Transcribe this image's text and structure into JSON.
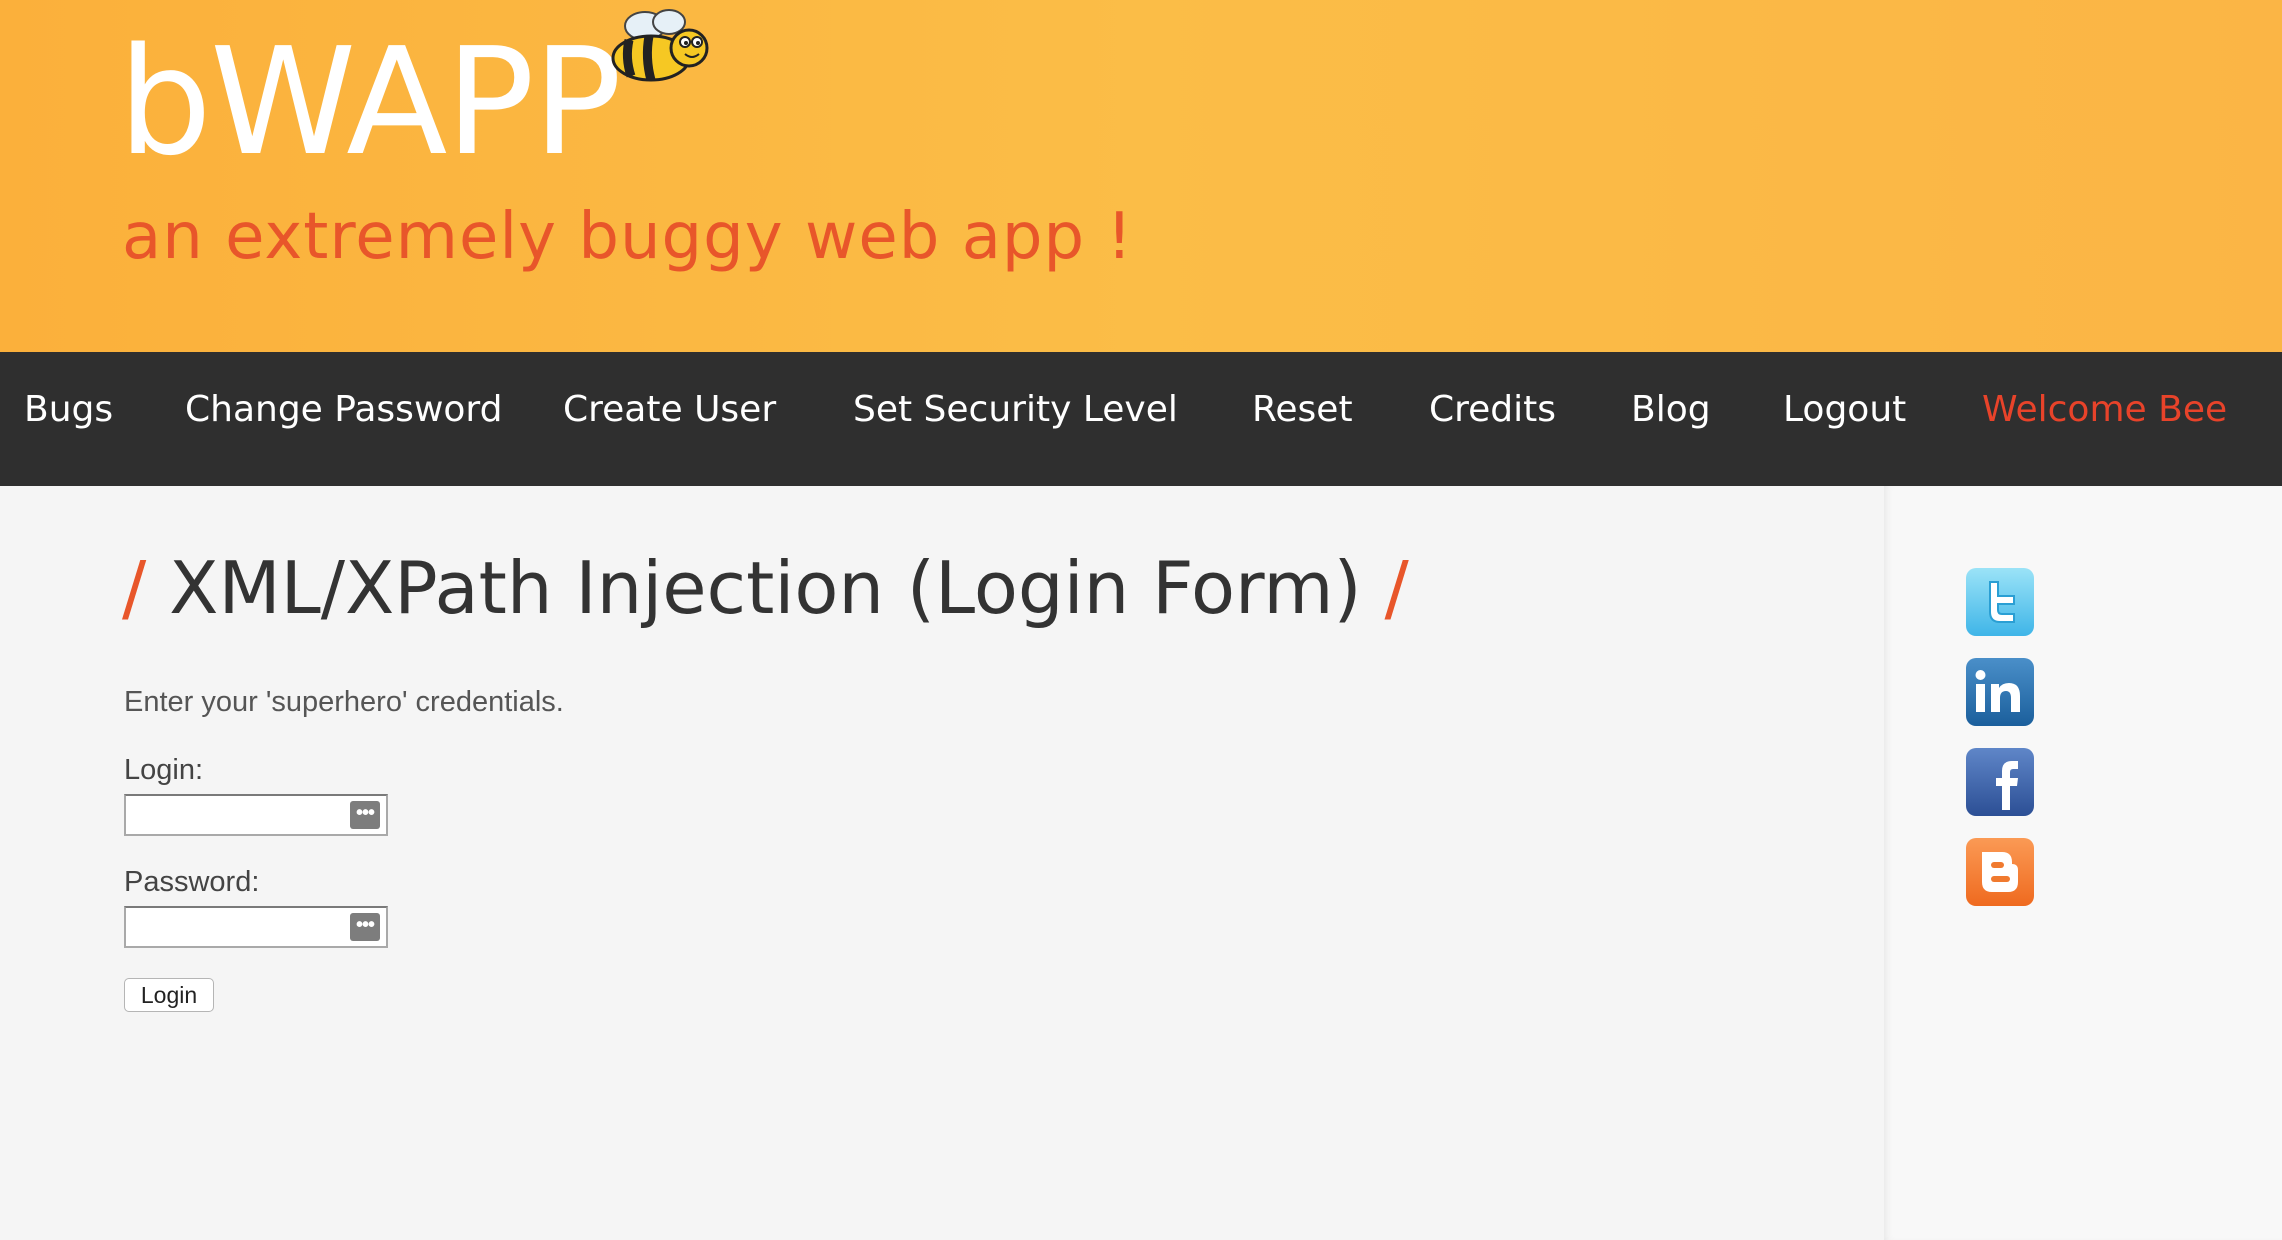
{
  "header": {
    "logo": "bWAPP",
    "tagline": "an extremely buggy web app !"
  },
  "nav": {
    "items": [
      "Bugs",
      "Change Password",
      "Create User",
      "Set Security Level",
      "Reset",
      "Credits",
      "Blog",
      "Logout"
    ],
    "welcome": "Welcome Bee"
  },
  "page": {
    "title_slash_left": "/",
    "title": "XML/XPath Injection (Login Form)",
    "title_slash_right": "/",
    "intro": "Enter your 'superhero' credentials.",
    "login_label": "Login:",
    "login_value": "",
    "password_label": "Password:",
    "password_value": "",
    "login_button": "Login",
    "password_key_glyph": "•••"
  },
  "colors": {
    "header_bg": "#fbb03b",
    "nav_bg": "#2f2f2f",
    "accent": "#e8562a",
    "welcome": "#e8432a"
  },
  "social": {
    "icons": [
      "twitter-icon",
      "linkedin-icon",
      "facebook-icon",
      "blogger-icon"
    ]
  }
}
